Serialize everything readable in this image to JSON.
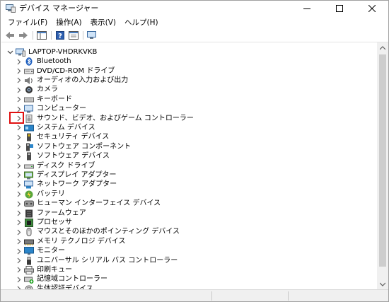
{
  "window": {
    "title": "デバイス マネージャー"
  },
  "menu": [
    "ファイル(F)",
    "操作(A)",
    "表示(V)",
    "ヘルプ(H)"
  ],
  "tree": {
    "root": "LAPTOP-VHDRKVKB",
    "items": [
      {
        "label": "Bluetooth",
        "icon": "bluetooth-icon"
      },
      {
        "label": "DVD/CD-ROM ドライブ",
        "icon": "disc-drive-icon"
      },
      {
        "label": "オーディオの入力および出力",
        "icon": "audio-io-icon"
      },
      {
        "label": "カメラ",
        "icon": "camera-icon"
      },
      {
        "label": "キーボード",
        "icon": "keyboard-icon"
      },
      {
        "label": "コンピューター",
        "icon": "computer-icon"
      },
      {
        "label": "サウンド、ビデオ、およびゲーム コントローラー",
        "icon": "speaker-icon"
      },
      {
        "label": "システム デバイス",
        "icon": "system-device-icon"
      },
      {
        "label": "セキュリティ デバイス",
        "icon": "security-device-icon"
      },
      {
        "label": "ソフトウェア コンポーネント",
        "icon": "software-component-icon"
      },
      {
        "label": "ソフトウェア デバイス",
        "icon": "software-device-icon"
      },
      {
        "label": "ディスク ドライブ",
        "icon": "disk-drive-icon"
      },
      {
        "label": "ディスプレイ アダプター",
        "icon": "display-adapter-icon"
      },
      {
        "label": "ネットワーク アダプター",
        "icon": "network-adapter-icon"
      },
      {
        "label": "バッテリ",
        "icon": "battery-icon"
      },
      {
        "label": "ヒューマン インターフェイス デバイス",
        "icon": "hid-icon"
      },
      {
        "label": "ファームウェア",
        "icon": "firmware-icon"
      },
      {
        "label": "プロセッサ",
        "icon": "processor-icon"
      },
      {
        "label": "マウスとそのほかのポインティング デバイス",
        "icon": "mouse-icon"
      },
      {
        "label": "メモリ テクノロジ デバイス",
        "icon": "memory-icon"
      },
      {
        "label": "モニター",
        "icon": "monitor-icon"
      },
      {
        "label": "ユニバーサル シリアル バス コントローラー",
        "icon": "usb-icon"
      },
      {
        "label": "印刷キュー",
        "icon": "printer-icon"
      },
      {
        "label": "記憶域コントローラー",
        "icon": "storage-controller-icon"
      },
      {
        "label": "生体認証デバイス",
        "icon": "biometric-icon"
      }
    ]
  },
  "colors": {
    "highlight": "#e01010",
    "accent": "#0a63c9"
  }
}
